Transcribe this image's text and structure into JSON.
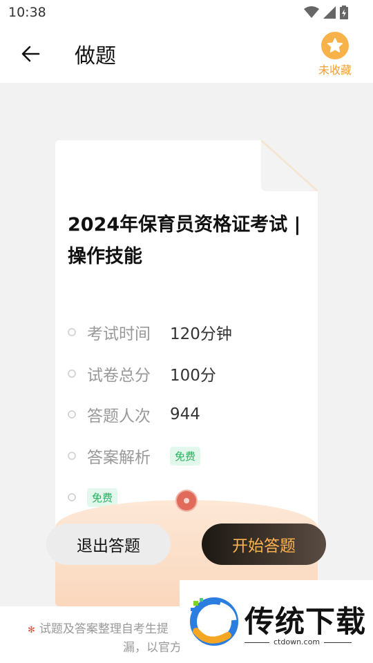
{
  "status_bar": {
    "time": "10:38"
  },
  "header": {
    "title": "做题",
    "favorite_label": "未收藏"
  },
  "exam": {
    "title": "2024年保育员资格证考试 | 操作技能",
    "rows": [
      {
        "label": "考试时间",
        "value": "120分钟"
      },
      {
        "label": "试卷总分",
        "value": "100分"
      },
      {
        "label": "答题人次",
        "value": "944"
      },
      {
        "label": "答案解析",
        "tag": "免费"
      },
      {
        "tag": "免费"
      }
    ]
  },
  "buttons": {
    "exit": "退出答题",
    "start": "开始答题"
  },
  "footer": {
    "line1": "试题及答案整理自考生提",
    "line2": "漏，以官方"
  },
  "watermark": {
    "brand": "传统下载",
    "url": "ctdown.com"
  },
  "colors": {
    "accent_orange": "#f7b24a",
    "start_text": "#ffb24e",
    "free_green": "#22b35c"
  }
}
